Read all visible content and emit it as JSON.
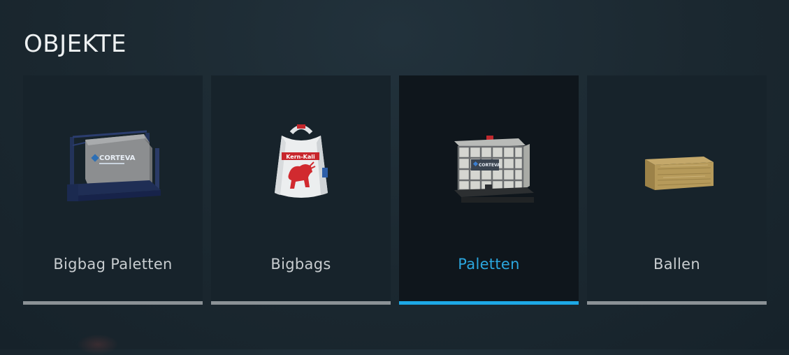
{
  "header": {
    "title": "OBJEKTE"
  },
  "categories": [
    {
      "label": "Bigbag Paletten",
      "icon": "bigbag-pallet-icon",
      "brand": "CORTEVA",
      "selected": false
    },
    {
      "label": "Bigbags",
      "icon": "bigbag-icon",
      "brand": "Kern-Kali",
      "selected": false
    },
    {
      "label": "Paletten",
      "icon": "ibc-tank-pallet-icon",
      "brand": "CORTEVA",
      "selected": true
    },
    {
      "label": "Ballen",
      "icon": "hay-bale-icon",
      "selected": false
    }
  ],
  "colors": {
    "accent": "#1da8e6",
    "selected_label": "#2ba6de",
    "card_background": "#17232b",
    "selected_card_background": "#0f161c",
    "inactive_bar": "#8b9296"
  }
}
